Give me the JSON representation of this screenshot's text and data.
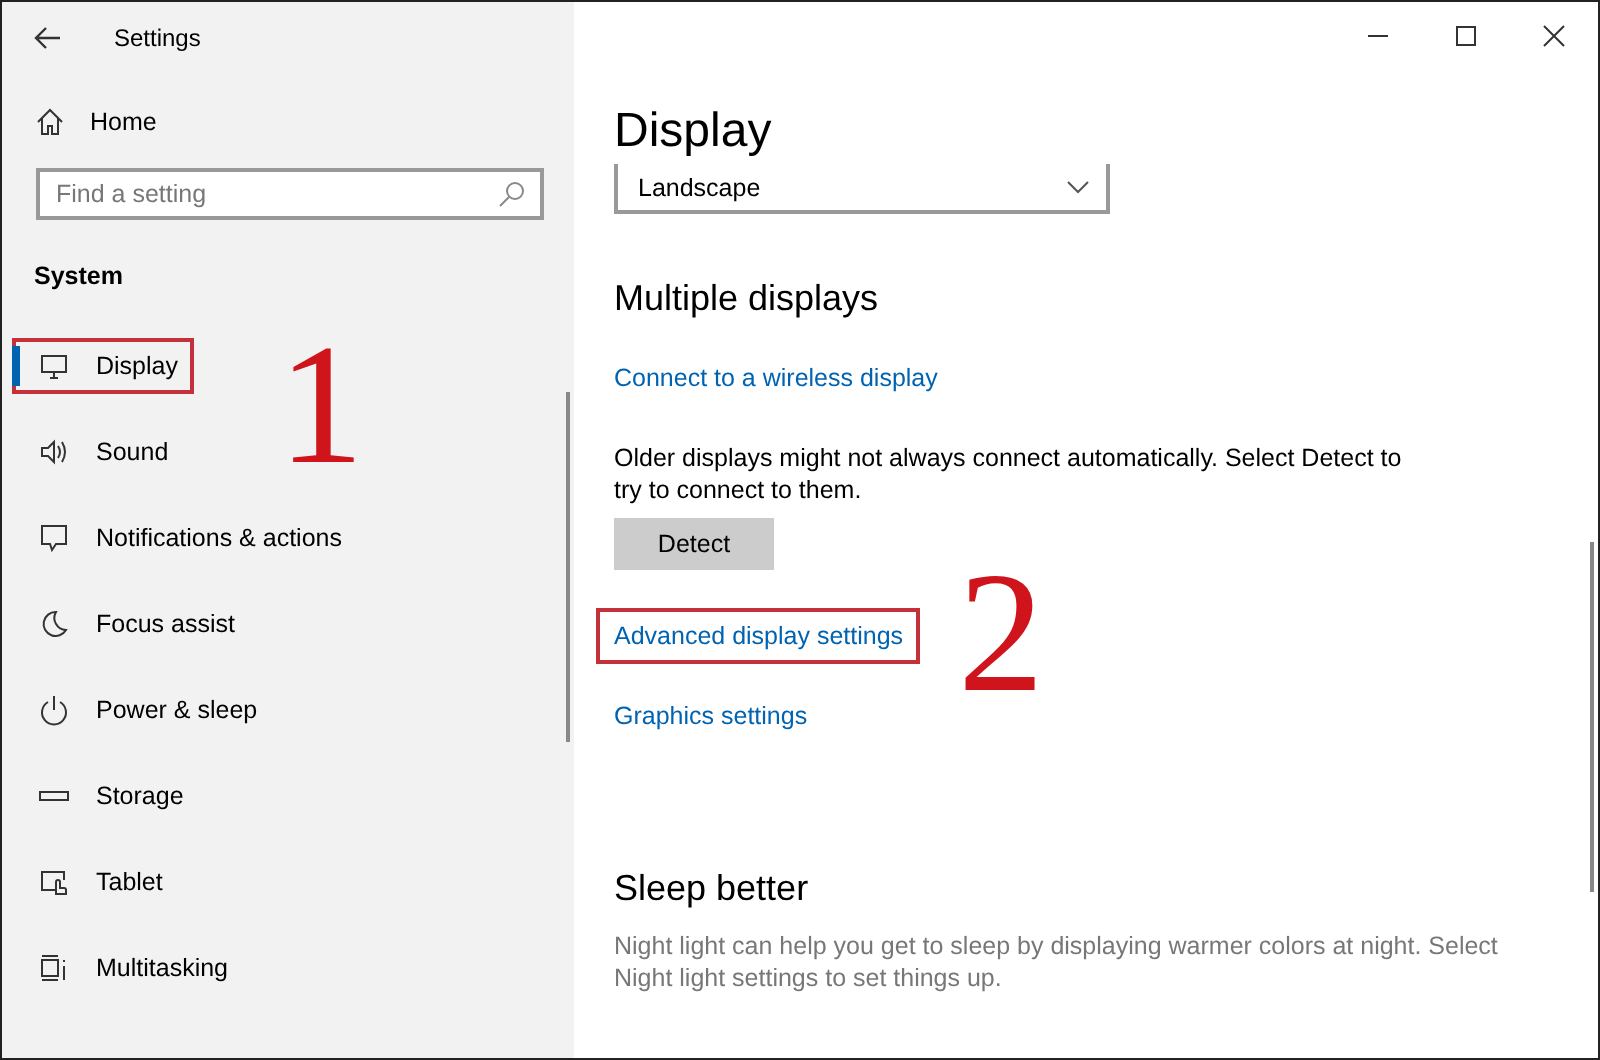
{
  "window": {
    "title": "Settings"
  },
  "sidebar": {
    "home": "Home",
    "search": {
      "placeholder": "Find a setting"
    },
    "section": "System",
    "items": [
      {
        "label": "Display",
        "selected": true,
        "highlighted": true
      },
      {
        "label": "Sound",
        "selected": false,
        "highlighted": false
      },
      {
        "label": "Notifications & actions",
        "selected": false,
        "highlighted": false
      },
      {
        "label": "Focus assist",
        "selected": false,
        "highlighted": false
      },
      {
        "label": "Power & sleep",
        "selected": false,
        "highlighted": false
      },
      {
        "label": "Storage",
        "selected": false,
        "highlighted": false
      },
      {
        "label": "Tablet",
        "selected": false,
        "highlighted": false
      },
      {
        "label": "Multitasking",
        "selected": false,
        "highlighted": false
      }
    ]
  },
  "content": {
    "title": "Display",
    "orientation": {
      "value": "Landscape"
    },
    "sections": [
      {
        "heading": "Multiple displays",
        "blocks": [
          {
            "kind": "link",
            "text": "Connect to a wireless display",
            "highlighted": false
          },
          {
            "kind": "text",
            "text": "Older displays might not always connect automatically. Select Detect to try to connect to them."
          },
          {
            "kind": "button",
            "text": "Detect"
          },
          {
            "kind": "link",
            "text": "Advanced display settings",
            "highlighted": true
          },
          {
            "kind": "link",
            "text": "Graphics settings",
            "highlighted": false
          }
        ]
      },
      {
        "heading": "Sleep better",
        "blocks": [
          {
            "kind": "note",
            "text": "Night light can help you get to sleep by displaying warmer colors at night. Select Night light settings to set things up."
          }
        ]
      }
    ]
  },
  "annotations": [
    {
      "text": "1"
    },
    {
      "text": "2"
    }
  ]
}
